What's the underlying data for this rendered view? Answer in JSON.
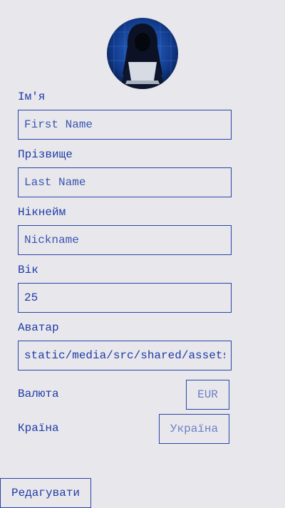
{
  "profile": {
    "avatar_icon": "hacker-avatar-image",
    "first_name": {
      "label": "Ім'я",
      "placeholder": "First Name",
      "value": ""
    },
    "last_name": {
      "label": "Прізвище",
      "placeholder": "Last Name",
      "value": ""
    },
    "nickname": {
      "label": "Нікнейм",
      "placeholder": "Nickname",
      "value": ""
    },
    "age": {
      "label": "Вік",
      "placeholder": "",
      "value": "25"
    },
    "avatar_url": {
      "label": "Аватар",
      "placeholder": "",
      "value": "static/media/src/shared/assets/"
    },
    "currency": {
      "label": "Валюта",
      "value": "EUR"
    },
    "country": {
      "label": "Країна",
      "value": "Україна"
    },
    "edit_label": "Редагувати"
  },
  "colors": {
    "background": "#e8e8ec",
    "primary": "#1f3aa6",
    "muted": "#6b7fc4"
  }
}
